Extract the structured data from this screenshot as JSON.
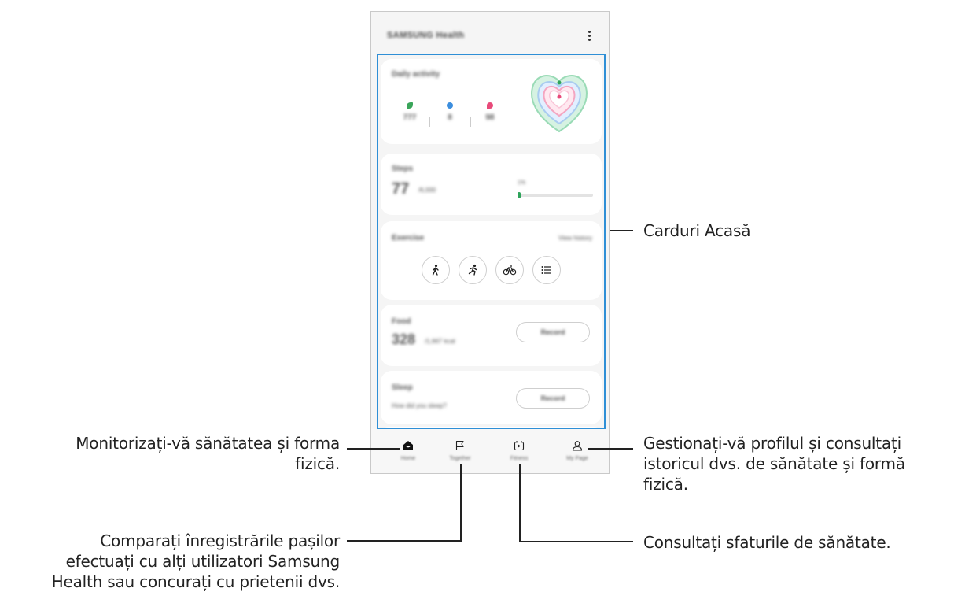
{
  "app": {
    "title": "SAMSUNG Health",
    "more_icon": "more-vertical-icon"
  },
  "cards": {
    "daily_activity": {
      "title": "Daily activity",
      "items": [
        {
          "icon": "steps-icon",
          "color": "#3aa55a",
          "value": "777"
        },
        {
          "icon": "active-time-icon",
          "color": "#3c8ede",
          "value": "8"
        },
        {
          "icon": "calories-icon",
          "color": "#e84a7a",
          "value": "98"
        }
      ]
    },
    "steps": {
      "title": "Steps",
      "value": "77",
      "goal": "/6,000",
      "percent_label": "1%",
      "progress": 0.01
    },
    "exercise": {
      "title": "Exercise",
      "link": "View history",
      "buttons": [
        "walking-icon",
        "running-icon",
        "cycling-icon",
        "list-icon"
      ]
    },
    "food": {
      "title": "Food",
      "value": "328",
      "goal": "/1,667 kcal",
      "button": "Record"
    },
    "sleep": {
      "title": "Sleep",
      "question": "How did you sleep?",
      "button": "Record"
    }
  },
  "nav": [
    {
      "icon": "home-icon",
      "label": "Home"
    },
    {
      "icon": "flag-icon",
      "label": "Together"
    },
    {
      "icon": "fitness-icon",
      "label": "Fitness"
    },
    {
      "icon": "profile-icon",
      "label": "My Page"
    }
  ],
  "callouts": {
    "home_cards": "Carduri Acasă",
    "monitor_line1": "Monitorizați-vă sănătatea și forma",
    "monitor_line2": "fizică.",
    "profile_line1": "Gestionați-vă profilul și consultați",
    "profile_line2": "istoricul dvs. de sănătate și formă",
    "profile_line3": "fizică.",
    "compare_line1": "Comparați înregistrările pașilor",
    "compare_line2": "efectuați cu alți utilizatori Samsung",
    "compare_line3": "Health sau concurați cu prietenii dvs.",
    "tips": "Consultați sfaturile de sănătate."
  }
}
